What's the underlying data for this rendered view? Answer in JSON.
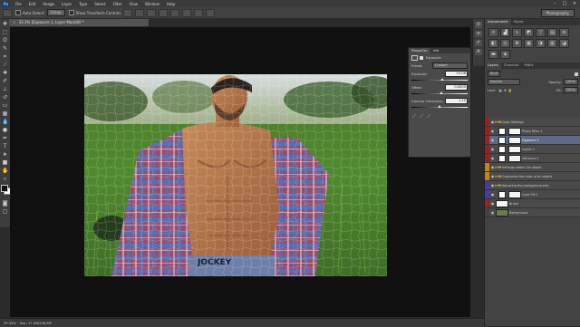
{
  "menubar": {
    "logo": "Ps",
    "items": [
      "File",
      "Edit",
      "Image",
      "Layer",
      "Type",
      "Select",
      "Filter",
      "View",
      "Window",
      "Help"
    ]
  },
  "options": {
    "auto_select_label": "Auto-Select:",
    "auto_select_value": "Group",
    "transform_label": "Show Transform Controls",
    "workspace": "Photography"
  },
  "document_tab": {
    "title": "33.3% (Exposure 1, Layer Mask/8) *"
  },
  "status": {
    "zoom": "33.33%",
    "doc": "Doc: 17.2M/248.6M"
  },
  "properties": {
    "tab_active": "Properties",
    "tab_other": "Info",
    "title": "Exposure",
    "preset_label": "Preset:",
    "preset_value": "Custom",
    "rows": [
      {
        "label": "Exposure:",
        "value": "+0.06"
      },
      {
        "label": "Offset:",
        "value": "0.0000"
      },
      {
        "label": "Gamma Correction:",
        "value": "1.10"
      }
    ],
    "slider_positions": [
      0.51,
      0.5,
      0.46
    ]
  },
  "adjustments": {
    "tab_active": "Adjustments",
    "tab_other": "Styles"
  },
  "layers_panel": {
    "tabs": [
      "Layers",
      "Channels",
      "Paths"
    ],
    "kind_label": "Kind",
    "blend_mode": "Normal",
    "opacity_label": "Opacity:",
    "opacity": "100%",
    "lock_label": "Lock:",
    "fill_label": "Fill:",
    "fill": "100%",
    "layers": [
      {
        "name": "Color Settings",
        "type": "group",
        "color": "#9c2020",
        "selected": false
      },
      {
        "name": "Photo Filter 1",
        "type": "adj",
        "color": "#9c2020",
        "selected": false
      },
      {
        "name": "Exposure 1",
        "type": "adj",
        "color": "#9c2020",
        "selected": true
      },
      {
        "name": "Levels 1",
        "type": "adj",
        "color": "#9c2020",
        "selected": false
      },
      {
        "name": "Vibrance 1",
        "type": "adj",
        "color": "#9c2020",
        "selected": false
      },
      {
        "name": "Settings within the object",
        "type": "group",
        "color": "#c8821c",
        "selected": false
      },
      {
        "name": "Customize the color of an object",
        "type": "group",
        "color": "#c8821c",
        "selected": false
      },
      {
        "name": "Adjusting the background and...",
        "type": "group",
        "color": "#4a3aa8",
        "selected": false
      },
      {
        "name": "Color Fill 1",
        "type": "fill",
        "color": "#4a3aa8",
        "selected": false
      },
      {
        "name": "Brush",
        "type": "layer",
        "color": "#9c2020",
        "selected": false
      },
      {
        "name": "Background",
        "type": "bg",
        "color": "#434343",
        "selected": false
      }
    ]
  },
  "colors": {
    "selected_layer": "#5b6a86",
    "canvas_bg": "#111111"
  }
}
